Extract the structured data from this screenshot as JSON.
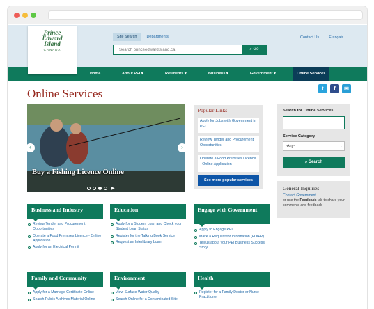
{
  "header": {
    "logo_text": [
      "Prince",
      "Edward",
      "Island"
    ],
    "logo_country": "CANADA",
    "tabs": [
      "Site Search",
      "Departments"
    ],
    "search_placeholder": "Search princeedwardisland.ca",
    "search_button": "Go",
    "top_links": [
      "Contact Us",
      "Français"
    ]
  },
  "nav": [
    "Home",
    "About PEI",
    "Residents",
    "Business",
    "Government",
    "Online Services"
  ],
  "page_title": "Online Services",
  "social": [
    "twitter-icon",
    "facebook-icon",
    "email-icon"
  ],
  "carousel": {
    "caption": "Buy a Fishing Licence Online",
    "dots": 4,
    "active_dot": 3
  },
  "popular": {
    "title": "Popular Links",
    "links": [
      "Apply for Jobs with Government in PEI",
      "Review Tender and Procurement Opportunities",
      "Operate a Food Premises Licence - Online Application"
    ],
    "more": "See more popular services"
  },
  "sidebar": {
    "search_label": "Search for Online Services",
    "category_label": "Service Category",
    "category_value": "-Any-",
    "search_button": "Search"
  },
  "inquiries": {
    "title": "General Inquiries",
    "link": "Contact Government",
    "text_before": "or use the ",
    "bold": "Feedback",
    "text_after": " tab to share your comments and feedback"
  },
  "cards": [
    {
      "title": "Business and Industry",
      "items": [
        "Review Tender and Procurement Opportunities",
        "Operate a Food Premises Licence - Online Application",
        "Apply for an Electrical Permit"
      ]
    },
    {
      "title": "Education",
      "items": [
        "Apply for a Student Loan and Check your Student Loan Status",
        "Register for the Talking Book Service",
        "Request an Interlibrary Loan"
      ]
    },
    {
      "title": "Engage with Government",
      "items": [
        "Apply to Engage PEI",
        "Make a Request for Information (FOIPP)",
        "Tell us about your PEI Business Success Story"
      ]
    },
    {
      "title": "Family and Community",
      "items": [
        "Apply for a Marriage Certificate Online",
        "Search Public Archives Material Online"
      ]
    },
    {
      "title": "Environment",
      "items": [
        "View Surface Water Quality",
        "Search Online for a Contaminated Site"
      ]
    },
    {
      "title": "Health",
      "items": [
        "Register for a Family Doctor or Nurse Practitioner"
      ]
    }
  ],
  "colors": {
    "green": "#0f7a5c",
    "navy": "#0b3d58",
    "red": "#96271d",
    "link": "#2068a6",
    "blue_btn": "#0d55a7"
  }
}
